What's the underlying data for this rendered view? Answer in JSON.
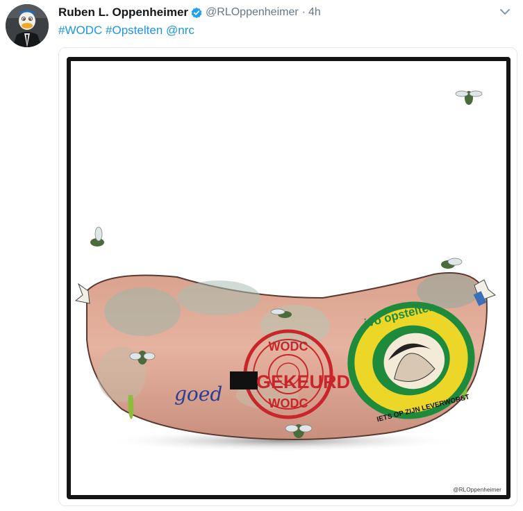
{
  "tweet": {
    "display_name": "Ruben L. Oppenheimer",
    "handle": "@RLOppenheimer",
    "separator": "·",
    "time": "4h",
    "text_parts": [
      "#WODC",
      "#Opstelten",
      "@nrc"
    ],
    "verified_color": "#1da1f2",
    "link_color": "#1b95e0"
  },
  "artwork": {
    "stamp_top": "WODC",
    "stamp_bottom": "WODC",
    "written_word": "goed",
    "stamp_word": "GEKEURD",
    "label_top": "ivo opstelten",
    "label_bottom": "IETS OP ZIJN LEVERWORST",
    "watermark": "@RLOppenheimer"
  }
}
